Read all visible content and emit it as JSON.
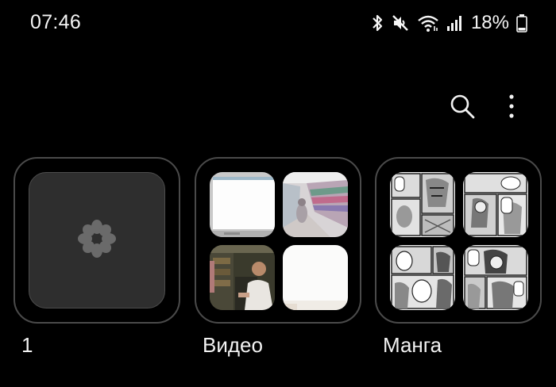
{
  "status_bar": {
    "time": "07:46",
    "icons": [
      "bluetooth-icon",
      "mute-icon",
      "wifi-icon",
      "signal-icon",
      "battery-icon"
    ],
    "battery_percent": "18%"
  },
  "toolbar": {
    "icons": [
      "search-icon",
      "more-vertical-icon"
    ]
  },
  "albums": [
    {
      "title": "1",
      "cover": "empty-placeholder"
    },
    {
      "title": "Видео",
      "thumbnails": [
        "video-thumb-screen",
        "video-thumb-store-aisle",
        "video-thumb-man-in-shop",
        "video-thumb-white"
      ]
    },
    {
      "title": "Манга",
      "thumbnails": [
        "manga-page-1",
        "manga-page-2",
        "manga-page-3",
        "manga-page-4"
      ]
    }
  ],
  "colors": {
    "background": "#000000",
    "card_border": "#4a4a4a",
    "empty_cover": "#2e2e2e",
    "text": "#f2f2f2"
  }
}
